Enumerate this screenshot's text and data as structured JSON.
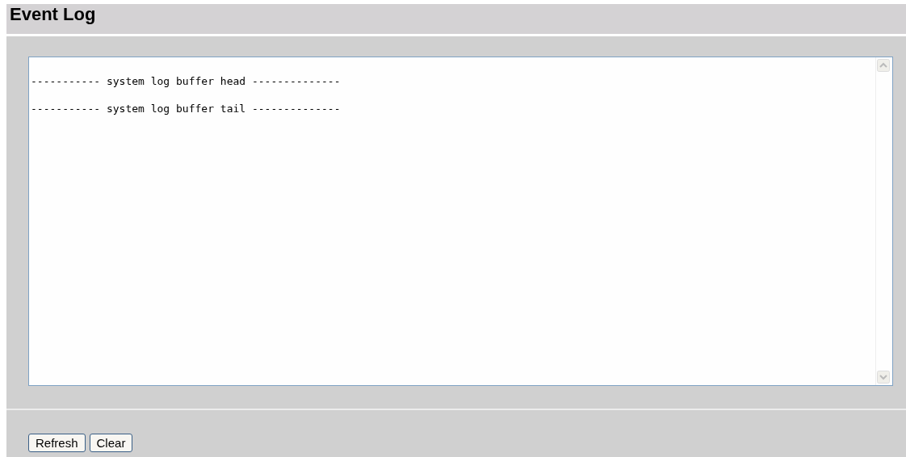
{
  "title": "Event Log",
  "log_lines": [
    "----------- system log buffer head --------------",
    "----------- system log buffer tail --------------"
  ],
  "buttons": [
    "Refresh",
    "Clear"
  ]
}
